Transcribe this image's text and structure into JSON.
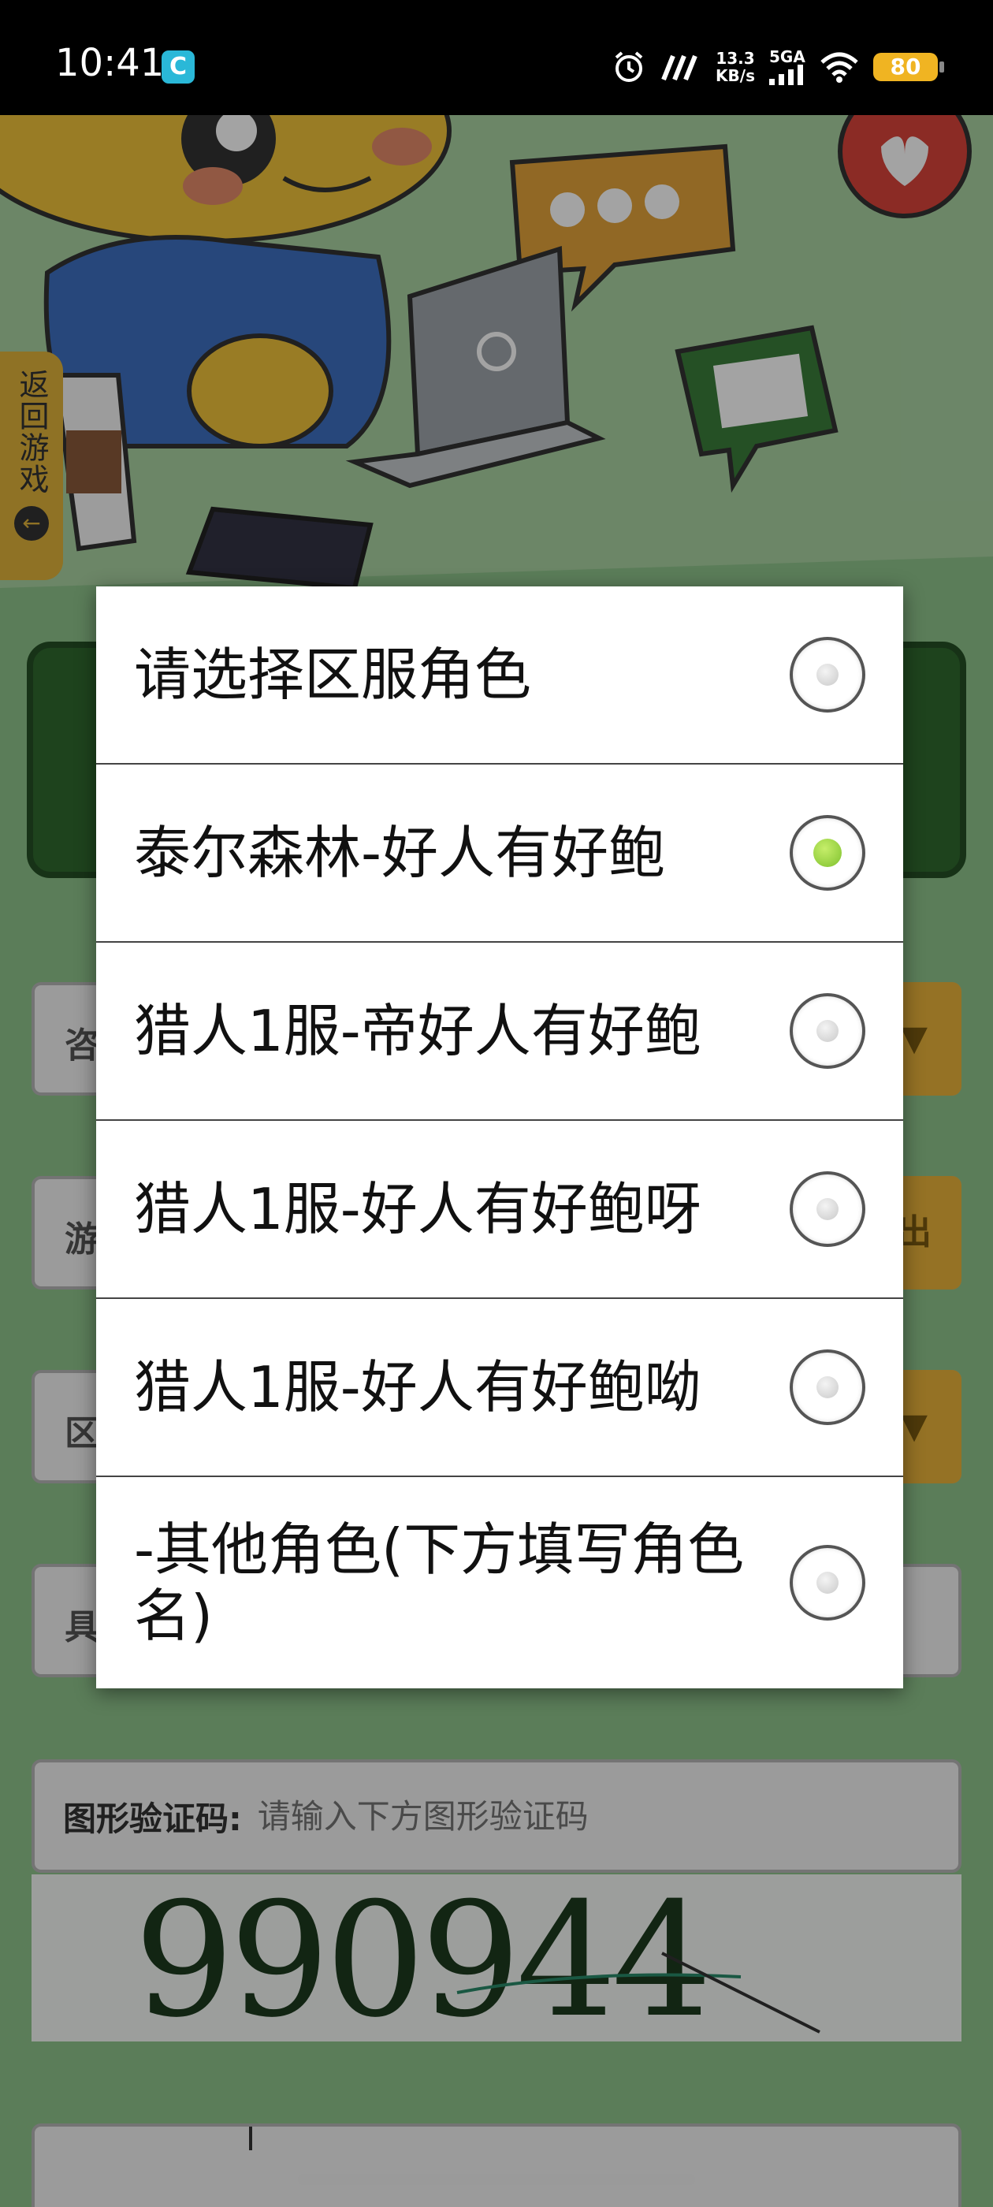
{
  "status_bar": {
    "time": "10:41",
    "app_icon": "C",
    "net_speed_value": "13.3",
    "net_speed_unit": "KB/s",
    "network": "5GA",
    "battery": "80"
  },
  "background": {
    "back_tab_label": "返回游戏",
    "row_stubs": [
      "咨",
      "游",
      "区",
      "具"
    ],
    "row_buttons": [
      "▼",
      "出",
      "▼"
    ],
    "captcha_label": "图形验证码:",
    "captcha_placeholder": "请输入下方图形验证码",
    "captcha_image_text": "990944"
  },
  "dialog": {
    "options": [
      {
        "label": "请选择区服角色",
        "checked": false
      },
      {
        "label": "泰尔森林-好人有好鲍",
        "checked": true
      },
      {
        "label": "猎人1服-帝好人有好鲍",
        "checked": false
      },
      {
        "label": "猎人1服-好人有好鲍呀",
        "checked": false
      },
      {
        "label": "猎人1服-好人有好鲍呦",
        "checked": false
      },
      {
        "label": "-其他角色(下方填写角色名)",
        "checked": false
      }
    ]
  },
  "colors": {
    "radio_checked": "#8cc63f",
    "background_green": "#8fc48c",
    "card_green": "#2f6a2e",
    "accent_yellow": "#e9b33a"
  }
}
